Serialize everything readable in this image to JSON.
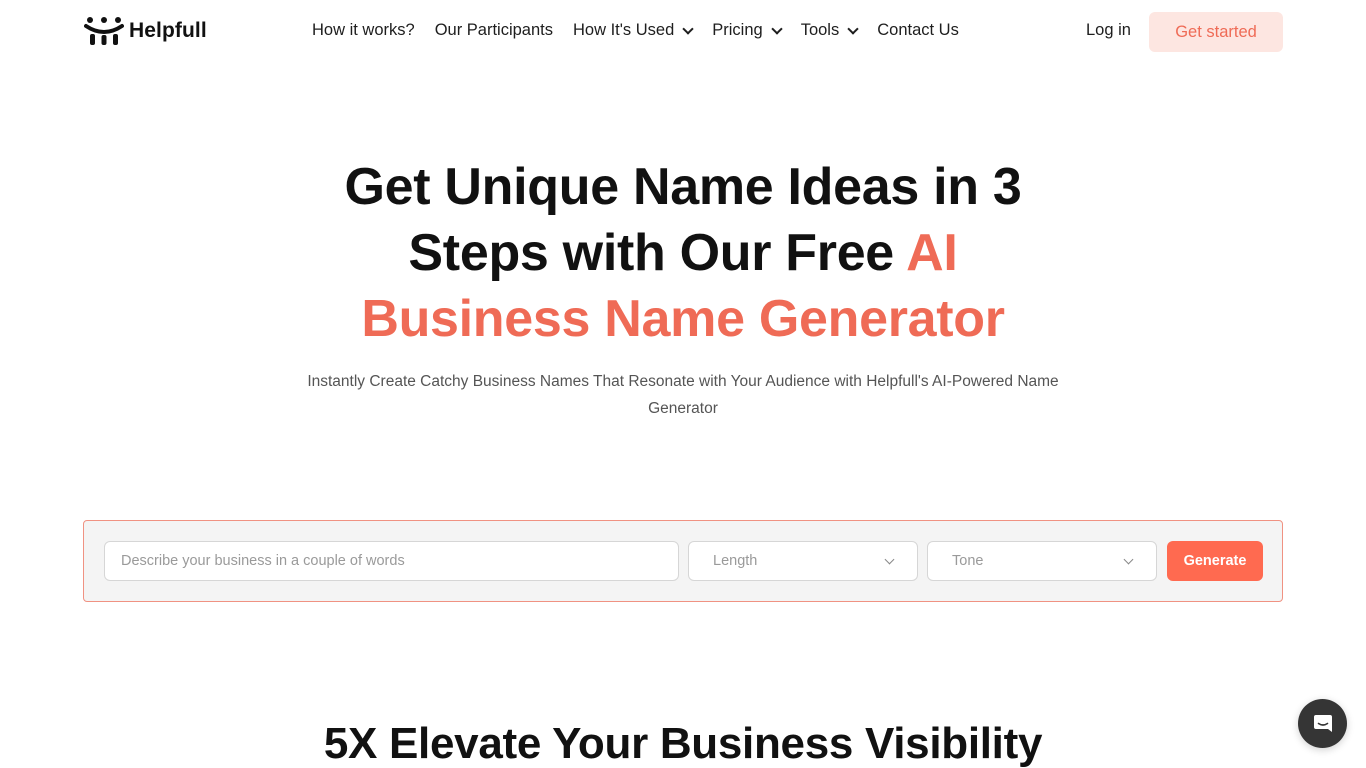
{
  "brand": {
    "name": "Helpfull",
    "accent_color": "#ef6b56",
    "button_color": "#ff6a50"
  },
  "nav": {
    "items": [
      {
        "label": "How it works?",
        "has_dropdown": false
      },
      {
        "label": "Our Participants",
        "has_dropdown": false
      },
      {
        "label": "How It's Used",
        "has_dropdown": true
      },
      {
        "label": "Pricing",
        "has_dropdown": true
      },
      {
        "label": "Tools",
        "has_dropdown": true
      },
      {
        "label": "Contact Us",
        "has_dropdown": false
      }
    ],
    "login_label": "Log in",
    "cta_label": "Get started"
  },
  "hero": {
    "title_line1": "Get Unique Name Ideas in 3",
    "title_line2_dark": "Steps with Our Free ",
    "title_line2_accent": "AI",
    "title_line3_accent": "Business Name Generator",
    "subtitle": "Instantly Create Catchy Business Names That Resonate with Your Audience with Helpfull's AI-Powered Name Generator"
  },
  "generator": {
    "input_placeholder": "Describe your business in a couple of words",
    "input_value": "",
    "length_label": "Length",
    "tone_label": "Tone",
    "generate_label": "Generate"
  },
  "section": {
    "title": "5X Elevate Your Business Visibility"
  },
  "chat": {
    "icon": "chat-icon"
  }
}
